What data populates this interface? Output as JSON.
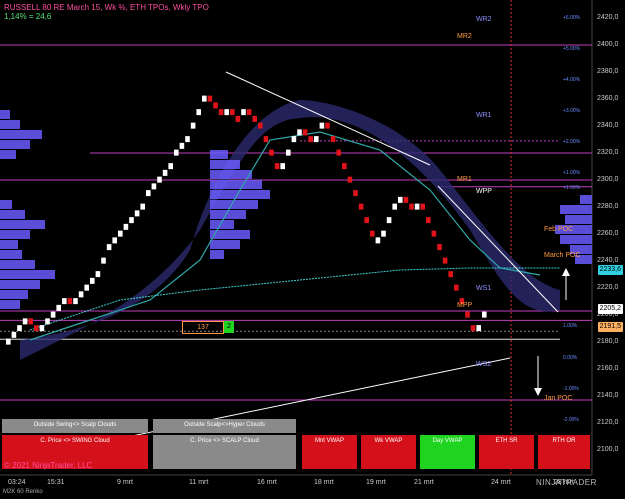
{
  "header": {
    "title": "RUSSELL 80 RE March 15, Wk %, ETH TPOs, Wkly TPO",
    "subtitle": "1,14% = 24,6"
  },
  "copyright": "© 2021 NinjaTrader, LLC",
  "status_text": "M2K 60 Renko",
  "logo_text": "NINJATRADER",
  "x_axis_labels": [
    "03:24",
    "15:31",
    "9 mrt",
    "11 mrt",
    "16 mrt",
    "18 mrt",
    "19 mrt",
    "21 mrt",
    "24 mrt",
    "28 mrt"
  ],
  "y_axis_labels": [
    "2420,0",
    "2400,0",
    "2380,0",
    "2360,0",
    "2340,0",
    "2320,0",
    "2300,0",
    "2280,0",
    "2260,0",
    "2240,0",
    "2220,0",
    "2200,0",
    "2180,0",
    "2160,0",
    "2140,0",
    "2120,0",
    "2100,0"
  ],
  "price_tags": {
    "cyan": "2233,6",
    "white": "2205,2",
    "orange": "2191,5"
  },
  "levels": {
    "wr2": "WR2",
    "mr2": "MR2",
    "wr1": "WR1",
    "mr1": "MR1",
    "wpp": "WPP",
    "mpp": "MPP",
    "ws1": "WS1",
    "ws2": "WS2",
    "feb_poc": "Feb POC",
    "march_poc": "March POC",
    "jan_poc": "Jan POC"
  },
  "percent_labels": [
    "+6.00%",
    "+5.00%",
    "+4.00%",
    "+3.00%",
    "+2.00%",
    "+1.00%",
    "+1.50%",
    "1.00%",
    "0.00%",
    "-1.00%",
    "-2.00%"
  ],
  "counter": {
    "value": "137",
    "badge": "2"
  },
  "buttons": {
    "outside_swing": "Outside Swing<> Scalp Clouds",
    "outside_scalp": "Outside Scalp<>Hyper Clouds",
    "c_price_swing": "C. Price <> SWING Cloud",
    "c_price_scalp": "C. Price <> SCALP Cloud",
    "mnt_vwap": "Mnt VWAP",
    "wk_vwap": "Wk VWAP",
    "day_vwap": "Day VWAP",
    "eth_sr": "ETH SR",
    "rth_or": "RTH OR"
  },
  "colors": {
    "up_brick": "#ffffff",
    "down_brick": "#e0121a",
    "flat_brick": "#9aa3ad",
    "profile": "#6a5cff",
    "cloud": "#2a2a6e",
    "magenta_line": "#c040c0",
    "cyan_line": "#40d0d0",
    "red_button": "#d4101a",
    "green_button": "#1ed41e",
    "gray_button": "#8a8a8a"
  }
}
